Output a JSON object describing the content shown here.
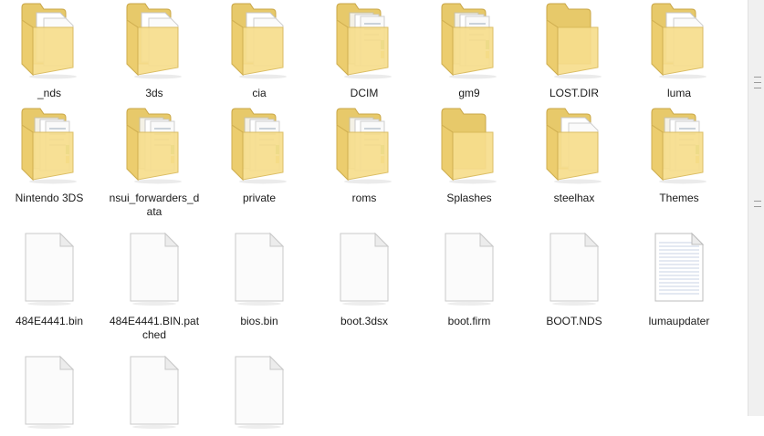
{
  "items": [
    {
      "type": "folder",
      "variant": "docs-white",
      "name": "_nds"
    },
    {
      "type": "folder",
      "variant": "docs-white",
      "name": "3ds"
    },
    {
      "type": "folder",
      "variant": "docs-white",
      "name": "cia"
    },
    {
      "type": "folder",
      "variant": "docs-mixed",
      "name": "DCIM"
    },
    {
      "type": "folder",
      "variant": "docs-mixed",
      "name": "gm9"
    },
    {
      "type": "folder",
      "variant": "empty",
      "name": "LOST.DIR"
    },
    {
      "type": "folder",
      "variant": "docs-white",
      "name": "luma"
    },
    {
      "type": "folder",
      "variant": "docs-mixed",
      "name": "Nintendo 3DS"
    },
    {
      "type": "folder",
      "variant": "docs-mixed",
      "name": "nsui_forwarders_data"
    },
    {
      "type": "folder",
      "variant": "docs-mixed",
      "name": "private"
    },
    {
      "type": "folder",
      "variant": "docs-mixed",
      "name": "roms"
    },
    {
      "type": "folder",
      "variant": "empty",
      "name": "Splashes"
    },
    {
      "type": "folder",
      "variant": "docs-white",
      "name": "steelhax"
    },
    {
      "type": "folder",
      "variant": "docs-mixed",
      "name": "Themes"
    },
    {
      "type": "file",
      "variant": "blank",
      "name": "484E4441.bin"
    },
    {
      "type": "file",
      "variant": "blank",
      "name": "484E4441.BIN.patched"
    },
    {
      "type": "file",
      "variant": "blank",
      "name": "bios.bin"
    },
    {
      "type": "file",
      "variant": "blank",
      "name": "boot.3dsx"
    },
    {
      "type": "file",
      "variant": "blank",
      "name": "boot.firm"
    },
    {
      "type": "file",
      "variant": "blank",
      "name": "BOOT.NDS"
    },
    {
      "type": "file",
      "variant": "text",
      "name": "lumaupdater"
    },
    {
      "type": "file",
      "variant": "blank",
      "name": ""
    },
    {
      "type": "file",
      "variant": "blank",
      "name": ""
    },
    {
      "type": "file",
      "variant": "blank",
      "name": ""
    }
  ]
}
